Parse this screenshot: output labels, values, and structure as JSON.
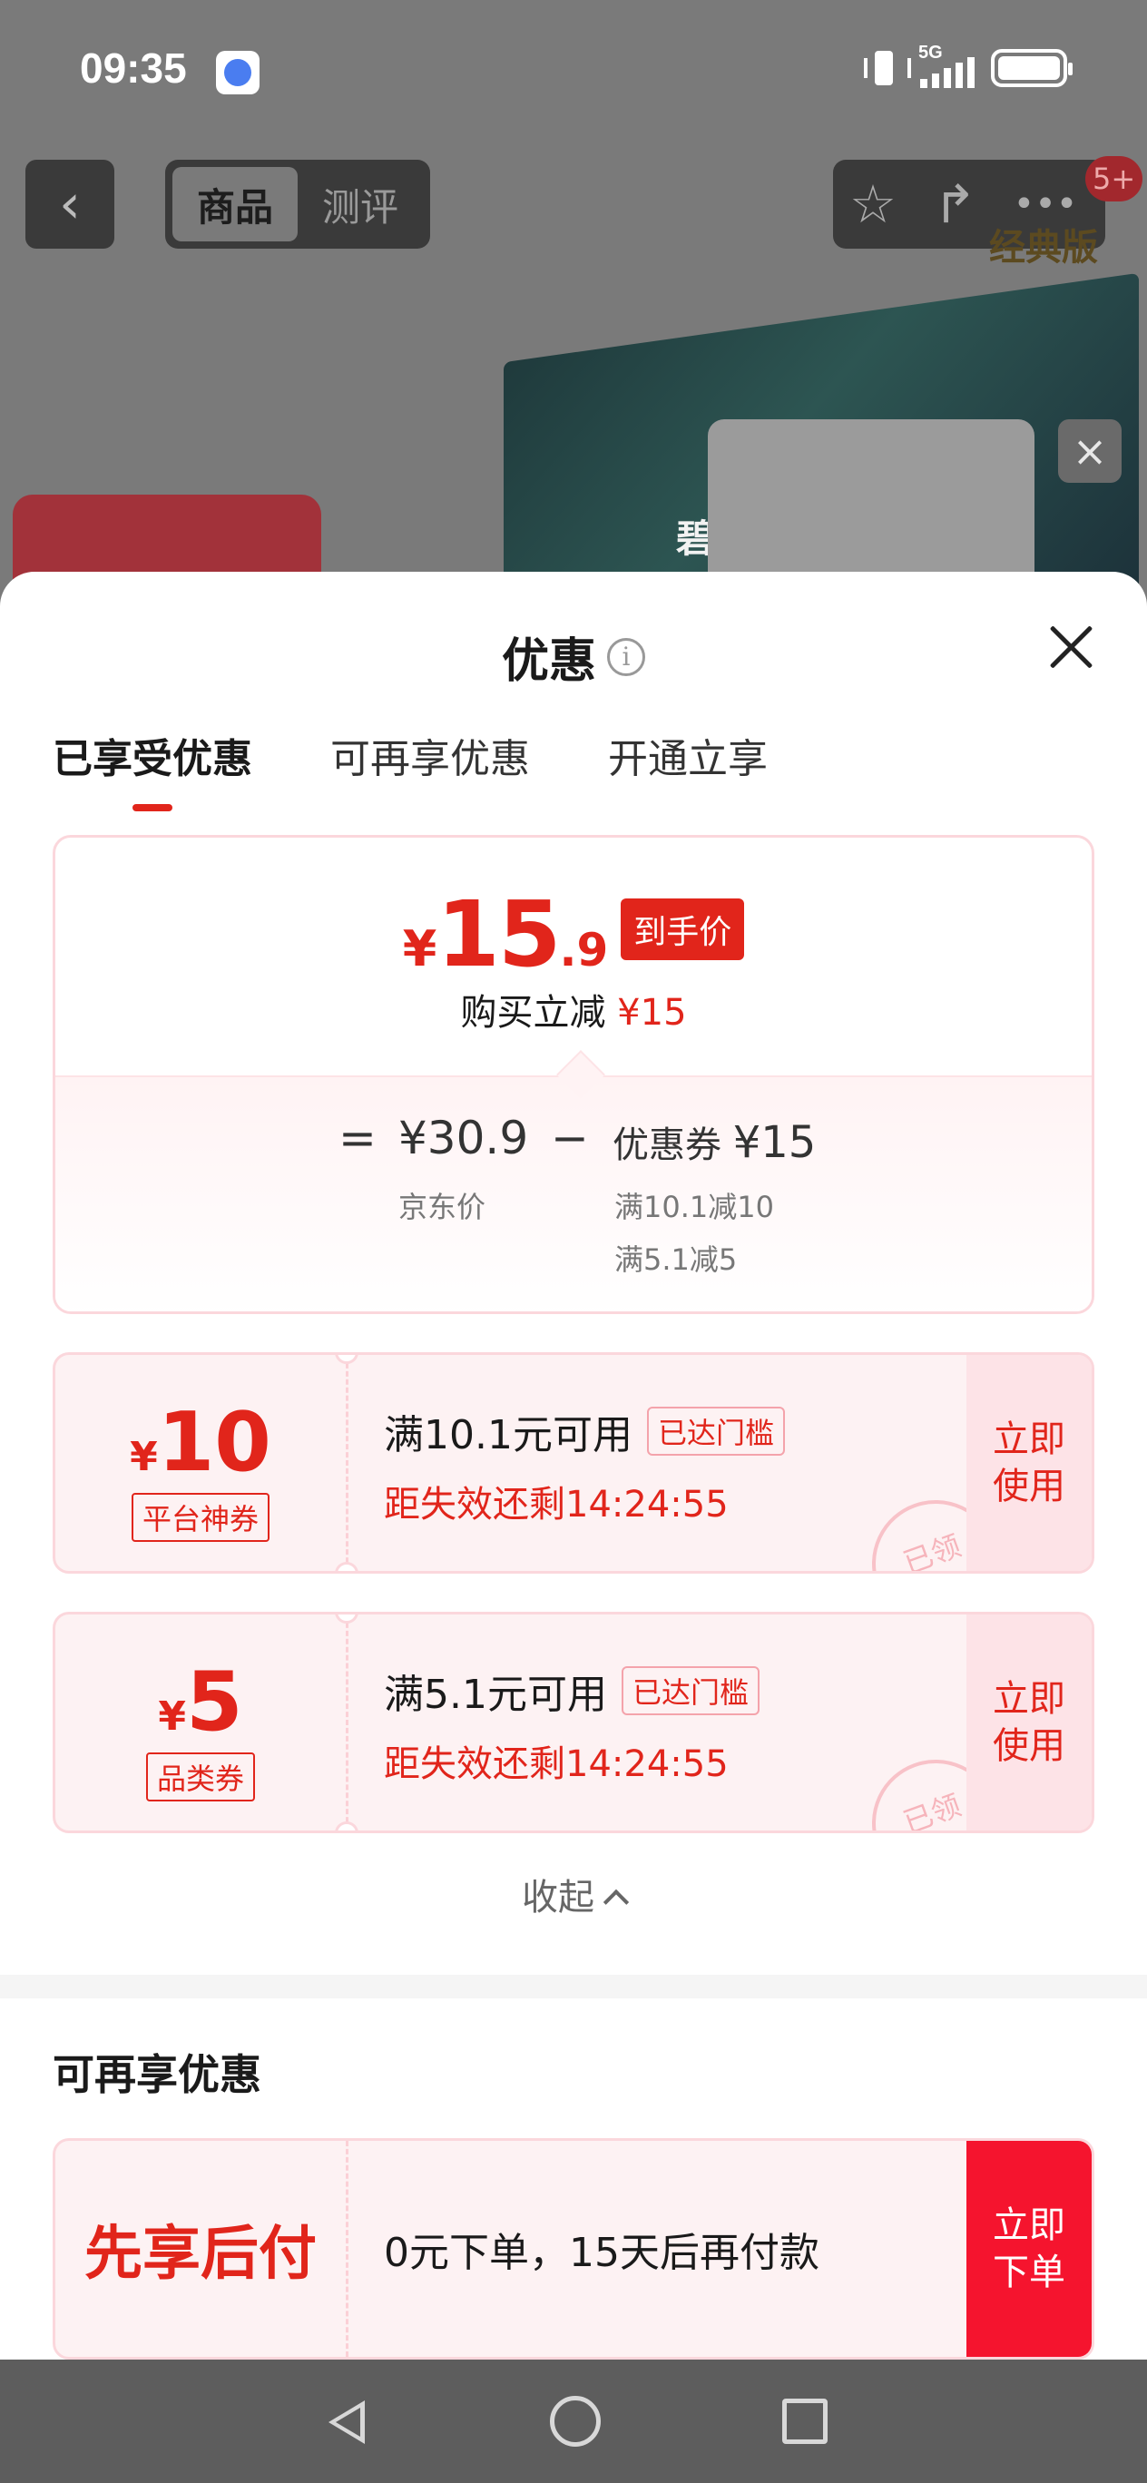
{
  "status_bar": {
    "time": "09:35",
    "network": "5G"
  },
  "product_nav": {
    "back_label": "‹",
    "tabs": [
      {
        "label": "商品"
      },
      {
        "label": "测评"
      }
    ],
    "badge": "5+",
    "seal": "经典版",
    "bg_product_text": "碧"
  },
  "sheet": {
    "title": "优惠",
    "tabs": [
      {
        "label": "已享受优惠"
      },
      {
        "label": "可再享优惠"
      },
      {
        "label": "开通立享"
      }
    ],
    "summary": {
      "currency": "¥",
      "price_int": "15",
      "price_dec": ".9",
      "price_tag": "到手价",
      "reduce_label": "购买立减",
      "reduce_value": "¥15",
      "eq": "=",
      "base_price": "¥30.9",
      "base_label": "京东价",
      "minus": "−",
      "coupon_label": "优惠券",
      "coupon_total": "¥15",
      "coupon_detail_1": "满10.1减10",
      "coupon_detail_2": "满5.1减5"
    },
    "coupons": [
      {
        "currency": "¥",
        "amount": "10",
        "type": "平台神券",
        "condition": "满10.1元可用",
        "badge": "已达门槛",
        "expire": "距失效还剩14:24:55",
        "stamp": "已领",
        "action": "立即使用"
      },
      {
        "currency": "¥",
        "amount": "5",
        "type": "品类券",
        "condition": "满5.1元可用",
        "badge": "已达门槛",
        "expire": "距失效还剩14:24:55",
        "stamp": "已领",
        "action": "立即使用"
      }
    ],
    "collapse_label": "收起",
    "more_section_title": "可再享优惠",
    "paylater": {
      "title": "先享后付",
      "desc": "0元下单，15天后再付款",
      "action": "立即下单"
    }
  },
  "colors": {
    "accent": "#e1251b",
    "coupon_bg": "#fdf2f3",
    "action_red": "#f5142e"
  }
}
